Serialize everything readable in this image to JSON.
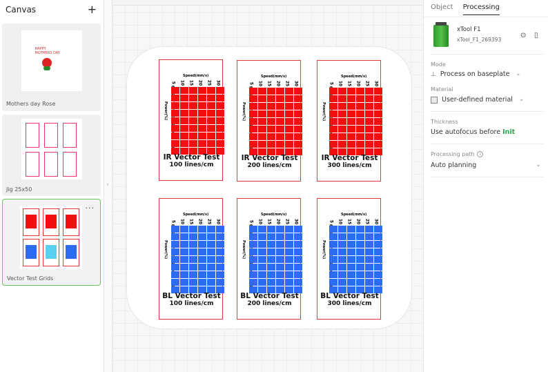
{
  "left": {
    "title": "Canvas",
    "add_label": "+",
    "canvases": [
      {
        "name": "Mothers day Rose",
        "thumb_text": "HAPPY MOTHERS DAY"
      },
      {
        "name": "Jig 25x50"
      },
      {
        "name": "Vector Test Grids",
        "more": "···"
      }
    ]
  },
  "canvas": {
    "grids": [
      {
        "speed_label": "Speed(mm/s)",
        "speed_values": [
          "5",
          "10",
          "15",
          "20",
          "25",
          "30"
        ],
        "power_label": "Power(%)",
        "power_values": [
          "60",
          "65",
          "70",
          "75",
          "80",
          "85",
          "90",
          "95",
          "100"
        ],
        "title": "IR Vector Test",
        "sub": "100 lines/cm",
        "color": "red"
      },
      {
        "speed_label": "Speed(mm/s)",
        "speed_values": [
          "5",
          "10",
          "15",
          "20",
          "25",
          "30"
        ],
        "power_label": "Power(%)",
        "power_values": [
          "60",
          "65",
          "70",
          "75",
          "80",
          "85",
          "90",
          "95",
          "100"
        ],
        "title": "IR Vector Test",
        "sub": "200 lines/cm",
        "color": "red"
      },
      {
        "speed_label": "Speed(mm/s)",
        "speed_values": [
          "5",
          "10",
          "15",
          "20",
          "25",
          "30"
        ],
        "power_label": "Power(%)",
        "power_values": [
          "60",
          "65",
          "70",
          "75",
          "80",
          "85",
          "90",
          "95",
          "100"
        ],
        "title": "IR Vector Test",
        "sub": "300 lines/cm",
        "color": "red"
      },
      {
        "speed_label": "Speed(mm/s)",
        "speed_values": [
          "5",
          "10",
          "15",
          "20",
          "25",
          "30"
        ],
        "power_label": "Power(%)",
        "power_values": [
          "60",
          "65",
          "70",
          "75",
          "80",
          "85",
          "90",
          "95",
          "100"
        ],
        "title": "BL Vector Test",
        "sub": "100 lines/cm",
        "color": "blue"
      },
      {
        "speed_label": "Speed(mm/s)",
        "speed_values": [
          "5",
          "10",
          "15",
          "20",
          "25",
          "30"
        ],
        "power_label": "Power(%)",
        "power_values": [
          "60",
          "65",
          "70",
          "75",
          "80",
          "85",
          "90",
          "95",
          "100"
        ],
        "title": "BL Vector Test",
        "sub": "200 lines/cm",
        "color": "blue"
      },
      {
        "speed_label": "Speed(mm/s)",
        "speed_values": [
          "5",
          "10",
          "15",
          "20",
          "25",
          "30"
        ],
        "power_label": "Power(%)",
        "power_values": [
          "60",
          "65",
          "70",
          "75",
          "80",
          "85",
          "90",
          "95",
          "100"
        ],
        "title": "BL Vector Test",
        "sub": "300 lines/cm",
        "color": "blue"
      }
    ]
  },
  "right": {
    "tabs": [
      "Object",
      "Processing"
    ],
    "device_name": "xTool F1",
    "device_id": "xTool_F1_269393",
    "mode_label": "Mode",
    "mode_value": "Process on baseplate",
    "material_label": "Material",
    "material_value": "User-defined material",
    "thickness_label": "Thickness",
    "thickness_text": "Use autofocus before",
    "thickness_link": "Init",
    "path_label": "Processing path",
    "path_value": "Auto planning"
  },
  "colors": {
    "accent": "#67c35b",
    "red_cell": "#f01010",
    "blue_cell": "#2b6cf0",
    "card_border": "#e03a3a"
  }
}
